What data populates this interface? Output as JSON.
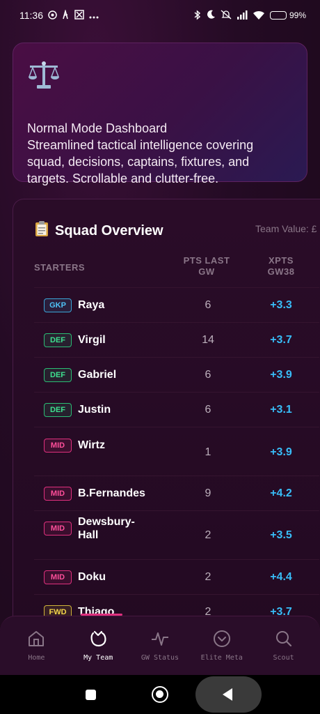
{
  "status_bar": {
    "time": "11:36",
    "battery": "99%",
    "battery_level": 0.99,
    "left_icons": [
      "chrome-icon",
      "liverpool-icon",
      "app-icon",
      "more-dots-icon"
    ],
    "right_icons": [
      "bluetooth-icon",
      "moon-icon",
      "mute-icon",
      "signal-icon",
      "wifi-icon",
      "battery-icon"
    ]
  },
  "hero": {
    "icon": "balance-scale-icon",
    "title": "Normal Mode Dashboard",
    "description": "Streamlined tactical intelligence covering squad, decisions, captains, fixtures, and targets. Scrollable and clutter-free."
  },
  "squad": {
    "title": "Squad Overview",
    "icon": "clipboard-icon",
    "team_value": "Team Value: £",
    "columns": {
      "starters": "STARTERS",
      "pts_last_gw": "PTS LAST GW",
      "xpts": "XPTS GW38"
    },
    "rows": [
      {
        "pos": "GKP",
        "name": "Raya",
        "pts": "6",
        "xpts": "+3.3"
      },
      {
        "pos": "DEF",
        "name": "Virgil",
        "pts": "14",
        "xpts": "+3.7"
      },
      {
        "pos": "DEF",
        "name": "Gabriel",
        "pts": "6",
        "xpts": "+3.9"
      },
      {
        "pos": "DEF",
        "name": "Justin",
        "pts": "6",
        "xpts": "+3.1"
      },
      {
        "pos": "MID",
        "name": "Wirtz",
        "pts": "1",
        "xpts": "+3.9"
      },
      {
        "pos": "MID",
        "name": "B.Fernandes",
        "pts": "9",
        "xpts": "+4.2"
      },
      {
        "pos": "MID",
        "name": "Dewsbury-Hall",
        "pts": "2",
        "xpts": "+3.5"
      },
      {
        "pos": "MID",
        "name": "Doku",
        "pts": "2",
        "xpts": "+4.4"
      },
      {
        "pos": "FWD",
        "name": "Thiago",
        "pts": "2",
        "xpts": "+3.7"
      }
    ]
  },
  "nav": {
    "items": [
      {
        "label": "Home",
        "icon": "home-icon"
      },
      {
        "label": "My Team",
        "icon": "my-team-icon",
        "active": true
      },
      {
        "label": "GW Status",
        "icon": "pulse-icon"
      },
      {
        "label": "Elite Meta",
        "icon": "chevron-circle-icon"
      },
      {
        "label": "Scout",
        "icon": "search-icon"
      }
    ]
  },
  "colors": {
    "accent_pink": "#e0307e",
    "xpts_blue": "#38bdf8",
    "gkp": "#4fc3f7",
    "def": "#3ee08f",
    "mid": "#ff4f9a",
    "fwd": "#f3d54a"
  }
}
